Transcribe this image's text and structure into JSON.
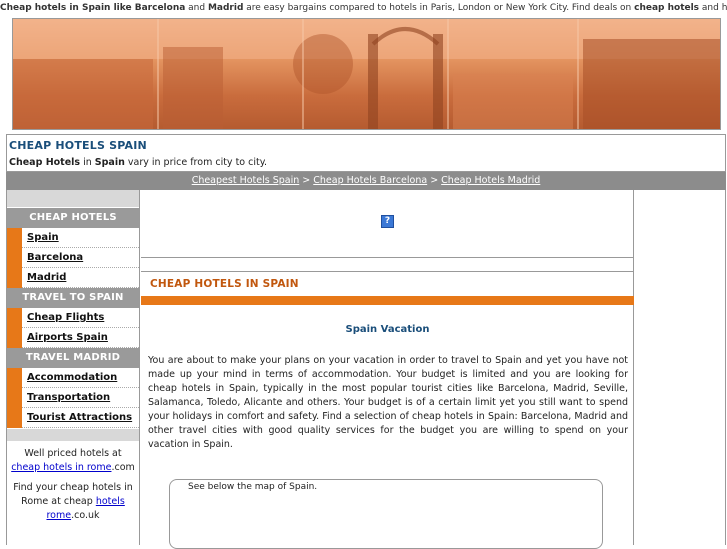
{
  "topbar": {
    "p1": "Cheap hotels in Spain like Barcelona",
    "p2": " and ",
    "p3": "Madrid",
    "p4": " are easy bargains compared to hotels in Paris, London or New York City. Find deals on ",
    "p5": "cheap hotels",
    "p6": " and hostels."
  },
  "header": {
    "title": "CHEAP HOTELS SPAIN",
    "tag_b1": "Cheap Hotels",
    "tag_t1": " in ",
    "tag_b2": "Spain",
    "tag_t2": " vary in price from city to city."
  },
  "breadcrumb": {
    "link1": "Cheapest Hotels Spain",
    "sep": " > ",
    "link2": "Cheap Hotels Barcelona",
    "link3": "Cheap Hotels Madrid"
  },
  "sidebar": {
    "section1": "CHEAP HOTELS",
    "items1": [
      "Spain",
      "Barcelona",
      "Madrid"
    ],
    "section2": "TRAVEL TO SPAIN",
    "items2": [
      "Cheap Flights",
      "Airports Spain"
    ],
    "section3": "TRAVEL MADRID",
    "items3": [
      "Accommodation",
      "Transportation",
      "Tourist Attractions"
    ],
    "note1_a": "Well priced hotels at ",
    "note1_link": "cheap hotels in rome",
    "note1_b": ".com",
    "note2_a": "Find your cheap hotels in Rome at cheap ",
    "note2_link": "hotels rome",
    "note2_b": ".co.uk"
  },
  "main": {
    "ad_icon": "?",
    "section_title": "CHEAP HOTELS IN SPAIN",
    "subheading": "Spain Vacation",
    "paragraph": "You are about to make your plans on your vacation in order to travel to Spain and yet you have not made up your mind in terms of accommodation. Your budget is limited and you are looking for cheap hotels in Spain, typically in the most popular tourist cities like Barcelona, Madrid, Seville, Salamanca, Toledo, Alicante and others. Your budget is of a certain limit yet you still want to spend your holidays in comfort and safety. Find a selection of cheap hotels in Spain: Barcelona, Madrid and other travel cities with good quality services for the budget you are willing to spend on your vacation in Spain.",
    "map_caption": "See below the map of Spain."
  },
  "colors": {
    "accent": "#e77818",
    "title": "#1a4e7a",
    "section_title": "#c1570e",
    "sidebar_head": "#9a9a9a"
  }
}
